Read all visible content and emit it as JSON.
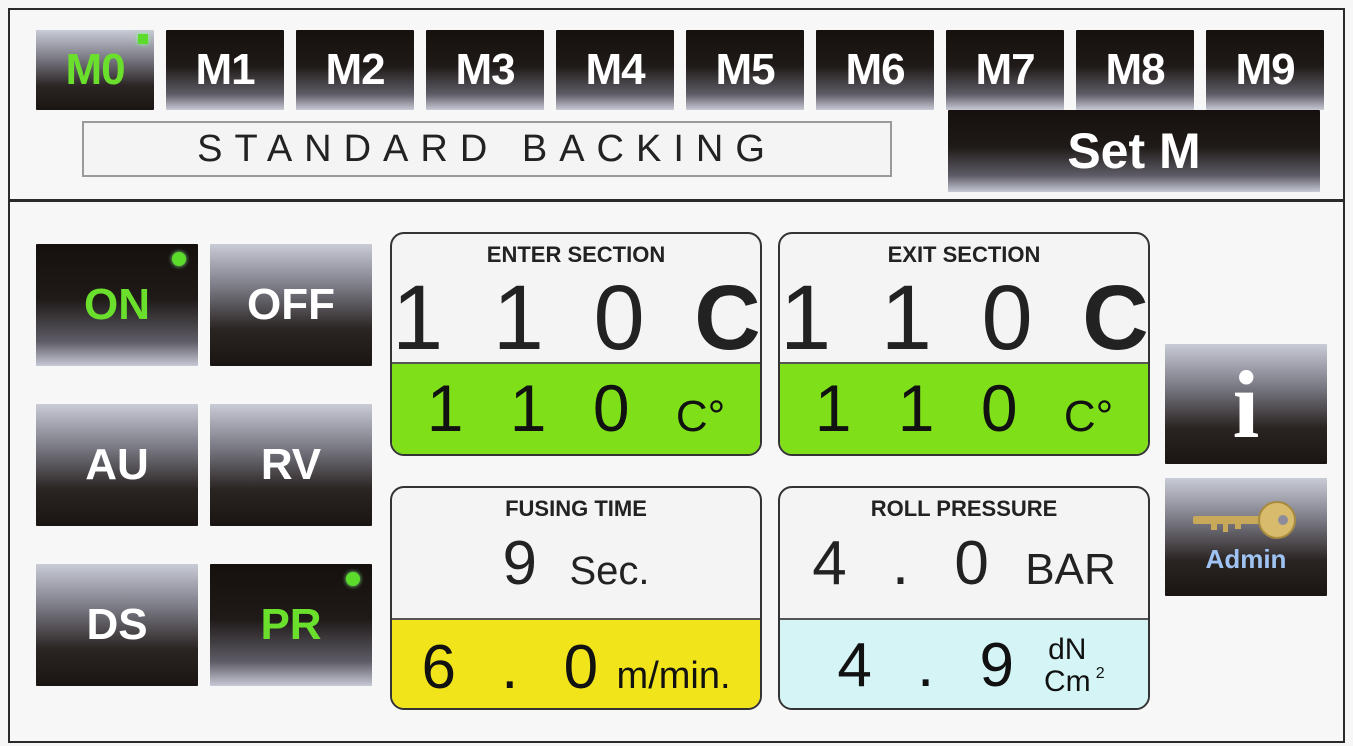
{
  "memory_tabs": [
    {
      "label": "M0",
      "active": true
    },
    {
      "label": "M1",
      "active": false
    },
    {
      "label": "M2",
      "active": false
    },
    {
      "label": "M3",
      "active": false
    },
    {
      "label": "M4",
      "active": false
    },
    {
      "label": "M5",
      "active": false
    },
    {
      "label": "M6",
      "active": false
    },
    {
      "label": "M7",
      "active": false
    },
    {
      "label": "M8",
      "active": false
    },
    {
      "label": "M9",
      "active": false
    }
  ],
  "program_name": "STANDARD BACKING",
  "set_memory_label": "Set M",
  "side_buttons": {
    "on": "ON",
    "off": "OFF",
    "au": "AU",
    "rv": "RV",
    "ds": "DS",
    "pr": "PR"
  },
  "enter_section": {
    "title": "ENTER SECTION",
    "setpoint": "1 1 0",
    "setpoint_unit": "C°",
    "actual": "1 1 0",
    "actual_unit": "C°"
  },
  "exit_section": {
    "title": "EXIT SECTION",
    "setpoint": "1 1 0",
    "setpoint_unit": "C°",
    "actual": "1 1 0",
    "actual_unit": "C°"
  },
  "fusing_time": {
    "title": "FUSING TIME",
    "value": "9",
    "unit": "Sec.",
    "speed": "6 . 0",
    "speed_unit": "m/min."
  },
  "roll_pressure": {
    "title": "ROLL PRESSURE",
    "value": "4 . 0",
    "unit": "BAR",
    "force": "4 . 9",
    "force_unit_top": "dN",
    "force_unit_bottom": "Cm",
    "force_unit_exp": "2"
  },
  "info_label": "i",
  "admin_label": "Admin",
  "colors": {
    "active_green": "#6ae02c",
    "temp_green": "#7fe01a",
    "speed_yellow": "#f2e41a",
    "force_cyan": "#d5f4f6"
  }
}
